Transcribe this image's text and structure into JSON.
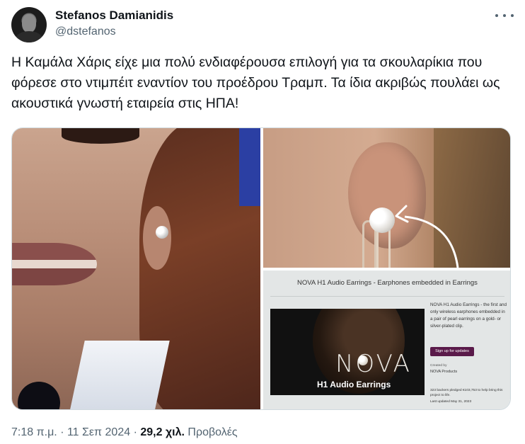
{
  "author": {
    "name": "Stefanos Damianidis",
    "handle": "@dstefanos"
  },
  "tweet": {
    "text": "Η Καμάλα Χάρις είχε μια πολύ ενδιαφέρουσα επιλογή για τα σκουλαρίκια που φόρεσε στο ντιμπέιτ εναντίον του προέδρου Τραμπ. Τα ίδια ακριβώς πουλάει ως ακουστικά γνωστή εταιρεία στις ΗΠΑ!"
  },
  "product_screenshot": {
    "title": "NOVA H1 Audio Earrings - Earphones embedded in Earrings",
    "logo": "NOVA",
    "logo_sub": "H1 Audio Earrings",
    "description": "NOVA H1 Audio Earrings - the first and only wireless earphones embedded in a pair of pearl earrings on a gold- or silver-plated clip.",
    "button_label": "Sign up for updates",
    "created_by_label": "Created by",
    "company": "NOVA Products",
    "backers": "323 backers pledged €103,753 to help bring this project to life.",
    "updated": "Last updated May 31, 2023"
  },
  "meta": {
    "time": "7:18 π.μ.",
    "sep1": "·",
    "date": "11 Σεπ 2024",
    "sep2": "·",
    "views_count": "29,2 χιλ.",
    "views_label": "Προβολές"
  },
  "icons": {
    "more": "more-horizontal-icon",
    "arrow": "curved-arrow-icon"
  }
}
